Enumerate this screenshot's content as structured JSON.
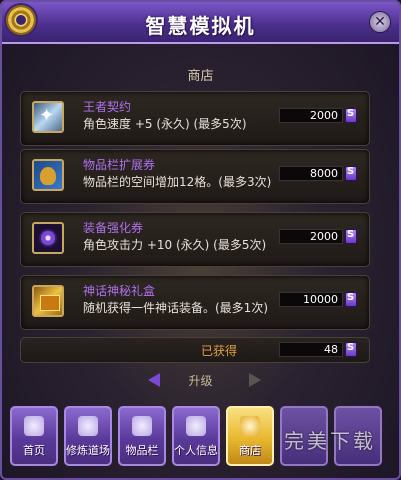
{
  "window": {
    "title": "智慧模拟机",
    "close_glyph": "✕"
  },
  "section": {
    "label": "商店"
  },
  "shop_items": [
    {
      "name": "王者契约",
      "desc": "角色速度 +5 (永久) (最多5次)",
      "price": "2000",
      "icon": "contract-icon"
    },
    {
      "name": "物品栏扩展券",
      "desc": "物品栏的空间增加12格。(最多3次)",
      "price": "8000",
      "icon": "bag-icon"
    },
    {
      "name": "装备强化券",
      "desc": "角色攻击力 +10 (永久) (最多5次)",
      "price": "2000",
      "icon": "gem-icon"
    },
    {
      "name": "神话神秘礼盒",
      "desc": "随机获得一件神话装备。(最多1次)",
      "price": "10000",
      "icon": "gift-box-icon"
    }
  ],
  "obtained": {
    "label": "已获得",
    "value": "48"
  },
  "upgrade": {
    "label": "升级"
  },
  "tabs": [
    {
      "label": "首页",
      "icon": "home-icon"
    },
    {
      "label": "修炼道场",
      "icon": "dojo-icon"
    },
    {
      "label": "物品栏",
      "icon": "inventory-icon"
    },
    {
      "label": "个人信息",
      "icon": "profile-icon"
    },
    {
      "label": "商店",
      "icon": "shop-icon"
    },
    {
      "label": "",
      "icon": ""
    },
    {
      "label": "",
      "icon": ""
    }
  ],
  "watermark": "完美下载",
  "colors": {
    "accent": "#7c56c8",
    "item_name": "#b070f0",
    "obtained_label": "#e0a040",
    "active_tab": "#e8b830"
  }
}
